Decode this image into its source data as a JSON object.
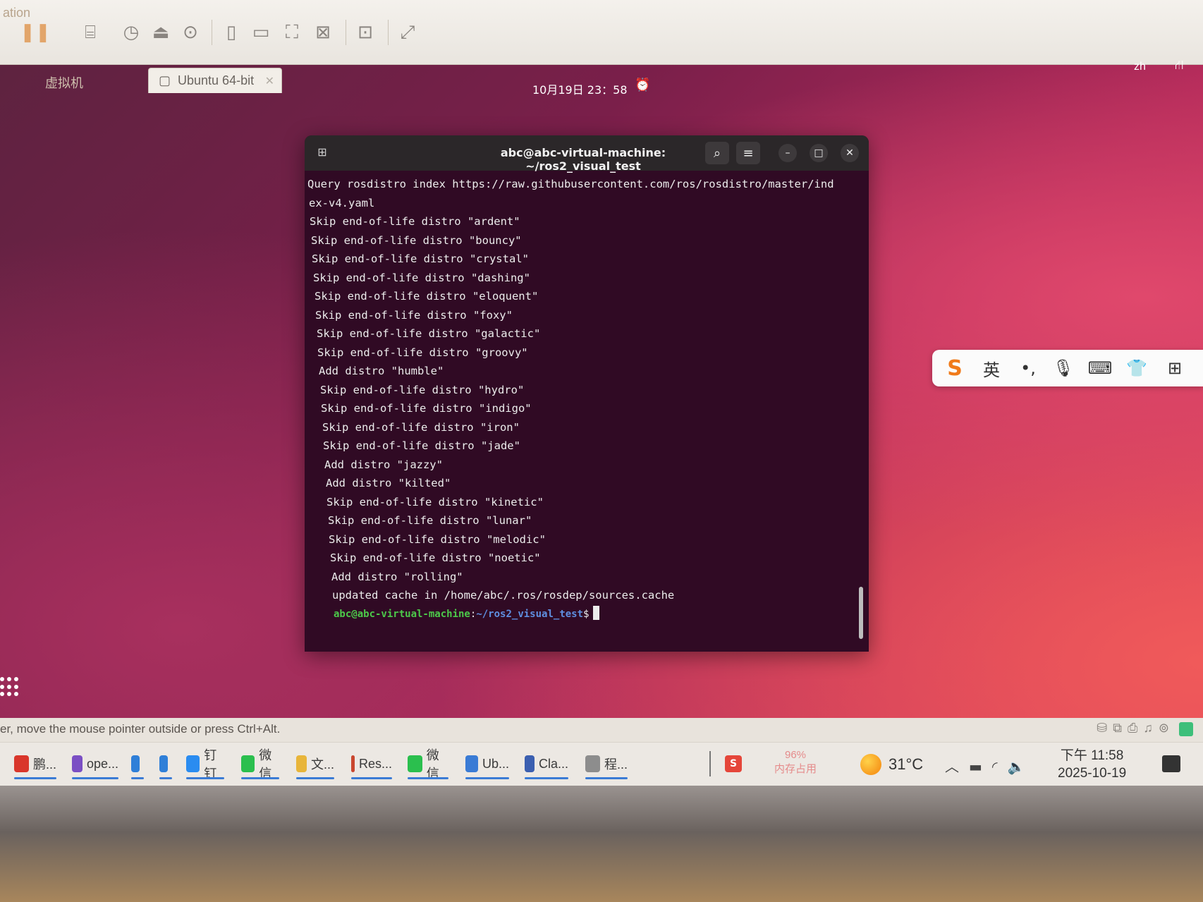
{
  "vm": {
    "window_label": "ation",
    "toolbar_icons": [
      "pause-icon",
      "network-icon",
      "snapshot-icon",
      "restore-icon",
      "snapshot-manager-icon",
      "sidebar-icon",
      "console-icon",
      "fit-guest-icon",
      "unity-icon",
      "terminal-icon",
      "fullscreen-icon"
    ],
    "tab_ghost": "虚拟机",
    "tab_label": "Ubuntu 64-bit",
    "status_message": "er, move the mouse pointer outside or press Ctrl+Alt."
  },
  "ubuntu": {
    "clock": "10月19日 23：58",
    "lang_indicator": "zh"
  },
  "terminal": {
    "title": "abc@abc-virtual-machine: ~/ros2_visual_test",
    "lines": [
      "Query rosdistro index https://raw.githubusercontent.com/ros/rosdistro/master/ind",
      "ex-v4.yaml",
      "Skip end-of-life distro \"ardent\"",
      "Skip end-of-life distro \"bouncy\"",
      "Skip end-of-life distro \"crystal\"",
      "Skip end-of-life distro \"dashing\"",
      "Skip end-of-life distro \"eloquent\"",
      "Skip end-of-life distro \"foxy\"",
      "Skip end-of-life distro \"galactic\"",
      "Skip end-of-life distro \"groovy\"",
      "Add distro \"humble\"",
      "Skip end-of-life distro \"hydro\"",
      "Skip end-of-life distro \"indigo\"",
      "Skip end-of-life distro \"iron\"",
      "Skip end-of-life distro \"jade\"",
      "Add distro \"jazzy\"",
      "Add distro \"kilted\"",
      "Skip end-of-life distro \"kinetic\"",
      "Skip end-of-life distro \"lunar\"",
      "Skip end-of-life distro \"melodic\"",
      "Skip end-of-life distro \"noetic\"",
      "Add distro \"rolling\"",
      "updated cache in /home/abc/.ros/rosdep/sources.cache"
    ],
    "prompt_user": "abc@abc-virtual-machine",
    "prompt_sep": ":",
    "prompt_path": "~/ros2_visual_test",
    "prompt_symbol": "$"
  },
  "ime": {
    "logo": "S",
    "mode": "英"
  },
  "taskbar": {
    "items": [
      {
        "icon": "wps-icon",
        "label": "鹏...",
        "color": "#d9362b"
      },
      {
        "icon": "visual-studio-icon",
        "label": "ope...",
        "color": "#7b4fc4"
      },
      {
        "icon": "vscode-icon",
        "label": "",
        "color": "#2f7fd8"
      },
      {
        "icon": "vscode-icon",
        "label": "",
        "color": "#2f7fd8"
      },
      {
        "icon": "dingtalk-icon",
        "label": "钉钉",
        "color": "#2a8cf0"
      },
      {
        "icon": "wechat-icon",
        "label": "微信",
        "color": "#2bbf4e"
      },
      {
        "icon": "folder-icon",
        "label": "文...",
        "color": "#e8b53a"
      },
      {
        "icon": "resource-icon",
        "label": "Res...",
        "color": "#c9472f"
      },
      {
        "icon": "wechat-icon",
        "label": "微信",
        "color": "#2bbf4e"
      },
      {
        "icon": "vmware-icon",
        "label": "Ub...",
        "color": "#3a7bd5"
      },
      {
        "icon": "claude-icon",
        "label": "Cla...",
        "color": "#3b5fb0"
      },
      {
        "icon": "app-icon",
        "label": "程...",
        "color": "#8d8d8d"
      }
    ],
    "memory_percent": "96%",
    "memory_label": "内存占用",
    "temperature": "31°C",
    "time": "下午 11:58",
    "date": "2025-10-19"
  }
}
